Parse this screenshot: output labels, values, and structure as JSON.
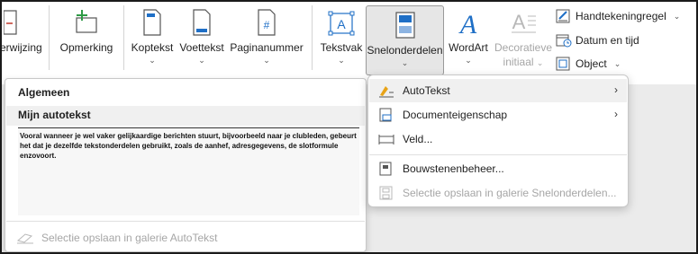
{
  "ribbon": {
    "buttons": [
      {
        "label": "erwijzing",
        "icon": "cross-reference-icon",
        "chevron": ""
      },
      {
        "label": "Opmerking",
        "icon": "comment-icon",
        "chevron": ""
      },
      {
        "label": "Koptekst",
        "icon": "header-icon",
        "chevron": "⌄"
      },
      {
        "label": "Voettekst",
        "icon": "footer-icon",
        "chevron": "⌄"
      },
      {
        "label": "Paginanummer",
        "icon": "page-number-icon",
        "chevron": "⌄"
      },
      {
        "label": "Tekstvak",
        "icon": "text-box-icon",
        "chevron": "⌄"
      },
      {
        "label": "Snelonderdelen",
        "icon": "quick-parts-icon",
        "chevron": "⌄"
      },
      {
        "label": "WordArt",
        "icon": "wordart-icon",
        "chevron": "⌄"
      },
      {
        "label": "Decoratieve",
        "label2": "initiaal",
        "icon": "drop-cap-icon",
        "chevron": "⌄"
      }
    ],
    "small": [
      {
        "label": "Handtekeningregel",
        "icon": "signature-line-icon",
        "chevron": "⌄"
      },
      {
        "label": "Datum en tijd",
        "icon": "date-time-icon",
        "chevron": ""
      },
      {
        "label": "Object",
        "icon": "object-icon",
        "chevron": "⌄"
      }
    ]
  },
  "panel": {
    "category": "Algemeen",
    "entry_title": "Mijn autotekst",
    "preview_text": "Vooral wanneer je wel vaker gelijkaardige berichten stuurt, bijvoorbeeld naar je clubleden, gebeurt het dat je dezelfde tekstonderdelen gebruikt, zoals de aanhef, adresgegevens, de slotformule enzovoort.",
    "footer": "Selectie opslaan in galerie AutoTekst"
  },
  "menu": {
    "items": [
      {
        "label": "AutoTekst",
        "icon": "autotext-icon",
        "submenu": true
      },
      {
        "label": "Documenteigenschap",
        "icon": "document-property-icon",
        "submenu": true
      },
      {
        "label": "Veld...",
        "icon": "field-icon",
        "submenu": false
      },
      {
        "label": "Bouwstenenbeheer...",
        "icon": "building-blocks-icon",
        "submenu": false
      },
      {
        "label": "Selectie opslaan in galerie Snelonderdelen...",
        "icon": "save-selection-icon",
        "submenu": false
      }
    ],
    "submenu_arrow": "›"
  },
  "colors": {
    "accent_blue": "#1f6fc6",
    "green": "#2e9a45",
    "highlight": "#f0f0f0",
    "disabled": "#a6a6a6"
  }
}
